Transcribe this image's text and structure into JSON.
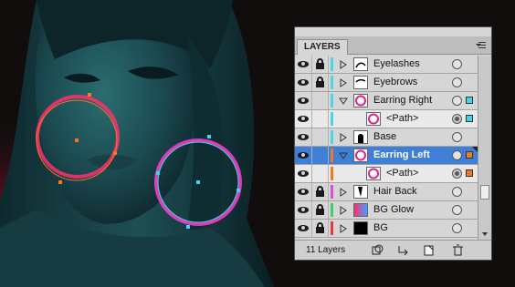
{
  "panel": {
    "tab_label": "LAYERS",
    "footer_count": "11 Layers"
  },
  "layers": [
    {
      "name": "Eyelashes",
      "color": "#4fd1e8",
      "thumb": "eyelashes",
      "expander": "closed",
      "row_type": "layer",
      "selected": false,
      "target": "empty",
      "select_color": ""
    },
    {
      "name": "Eyebrows",
      "color": "#4fd1e8",
      "thumb": "eyebrows",
      "expander": "closed",
      "row_type": "layer",
      "selected": false,
      "target": "empty",
      "select_color": ""
    },
    {
      "name": "Earring Right",
      "color": "#4fd1e8",
      "thumb": "ring",
      "expander": "open",
      "row_type": "layer",
      "selected": false,
      "target": "empty",
      "select_color": "#3ed7e8"
    },
    {
      "name": "<Path>",
      "color": "#4fd1e8",
      "thumb": "ring",
      "expander": "none",
      "row_type": "sub",
      "selected": false,
      "target": "filled",
      "select_color": "#3ed7e8"
    },
    {
      "name": "Base",
      "color": "#4fd1e8",
      "thumb": "silhouette",
      "expander": "closed",
      "row_type": "layer",
      "selected": false,
      "target": "empty",
      "select_color": ""
    },
    {
      "name": "Earring Left",
      "color": "#f07a23",
      "thumb": "ring",
      "expander": "open",
      "row_type": "layer",
      "selected": true,
      "target": "empty",
      "select_color": "#f07a23"
    },
    {
      "name": "<Path>",
      "color": "#f07a23",
      "thumb": "ring",
      "expander": "none",
      "row_type": "sub",
      "selected": false,
      "target": "filled",
      "select_color": "#f07a23"
    },
    {
      "name": "Hair Back",
      "color": "#d84fd8",
      "thumb": "hair",
      "expander": "closed",
      "row_type": "layer",
      "selected": false,
      "target": "empty",
      "select_color": ""
    },
    {
      "name": "BG Glow",
      "color": "#3fcf6a",
      "thumb": "glow",
      "expander": "closed",
      "row_type": "layer",
      "selected": false,
      "target": "empty",
      "select_color": ""
    },
    {
      "name": "BG",
      "color": "#e83a3a",
      "thumb": "bg",
      "expander": "closed",
      "row_type": "layer",
      "selected": false,
      "target": "empty",
      "select_color": ""
    }
  ],
  "footer_buttons": [
    {
      "icon": "make-clipping-mask-icon"
    },
    {
      "icon": "create-sublayer-icon"
    },
    {
      "icon": "create-new-layer-icon"
    },
    {
      "icon": "delete-layer-icon"
    }
  ],
  "colors": {
    "selection_highlight": "#3f7fd8",
    "earring_left_path": "#f07a23",
    "earring_right_path": "#3ed7e8",
    "earring_glow_left": "#ff2f6e",
    "earring_glow_right": "#ff3fd0"
  }
}
